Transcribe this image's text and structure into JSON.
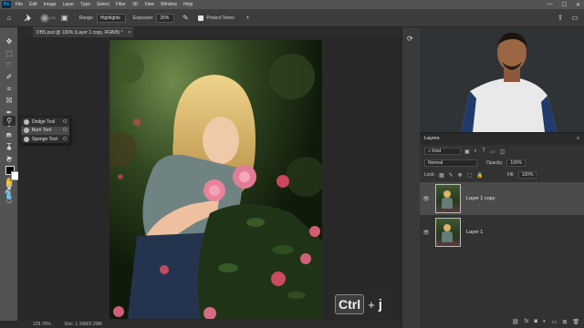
{
  "menu": {
    "logo": "Ps",
    "items": [
      "File",
      "Edit",
      "Image",
      "Layer",
      "Type",
      "Select",
      "Filter",
      "3D",
      "View",
      "Window",
      "Help"
    ],
    "window_controls": [
      "—",
      "☐",
      "✕"
    ]
  },
  "options": {
    "brush_size": "175",
    "range_label": "Range:",
    "range_value": "Highlights",
    "exposure_label": "Exposure:",
    "exposure_value": "25%",
    "protect_tones_label": "Protect Tones"
  },
  "flyout": {
    "items": [
      {
        "label": "Dodge Tool",
        "key": "O"
      },
      {
        "label": "Burn Tool",
        "key": "O"
      },
      {
        "label": "Sponge Tool",
        "key": "O"
      }
    ]
  },
  "document": {
    "tab_title": "DBS.psd @ 130% (Layer 1 copy, RGB/8) *",
    "close": "×"
  },
  "shortcut": {
    "key1": "Ctrl",
    "plus": "+",
    "key2": "j"
  },
  "status": {
    "zoom": "129.76%",
    "doc_size": "Doc: 1.10M/2.20M"
  },
  "layers_panel": {
    "title": "Layers",
    "menu_icon": "≡",
    "filter_kind": "Kind",
    "blend_mode": "Normal",
    "opacity_label": "Opacity:",
    "opacity_value": "100%",
    "lock_label": "Lock:",
    "fill_label": "Fill:",
    "fill_value": "100%",
    "layers": [
      {
        "name": "Layer 1 copy",
        "selected": true
      },
      {
        "name": "Layer 1",
        "selected": false
      }
    ],
    "bottom_icons": [
      "link-icon",
      "fx-icon",
      "mask-icon",
      "adjustment-icon",
      "group-icon",
      "new-layer-icon",
      "trash-icon"
    ]
  },
  "colors": {
    "app_bg": "#2b2b2b",
    "panel_bg": "#323232",
    "selected_layer": "#4b4b4b",
    "toolbar_bg": "#535353"
  }
}
